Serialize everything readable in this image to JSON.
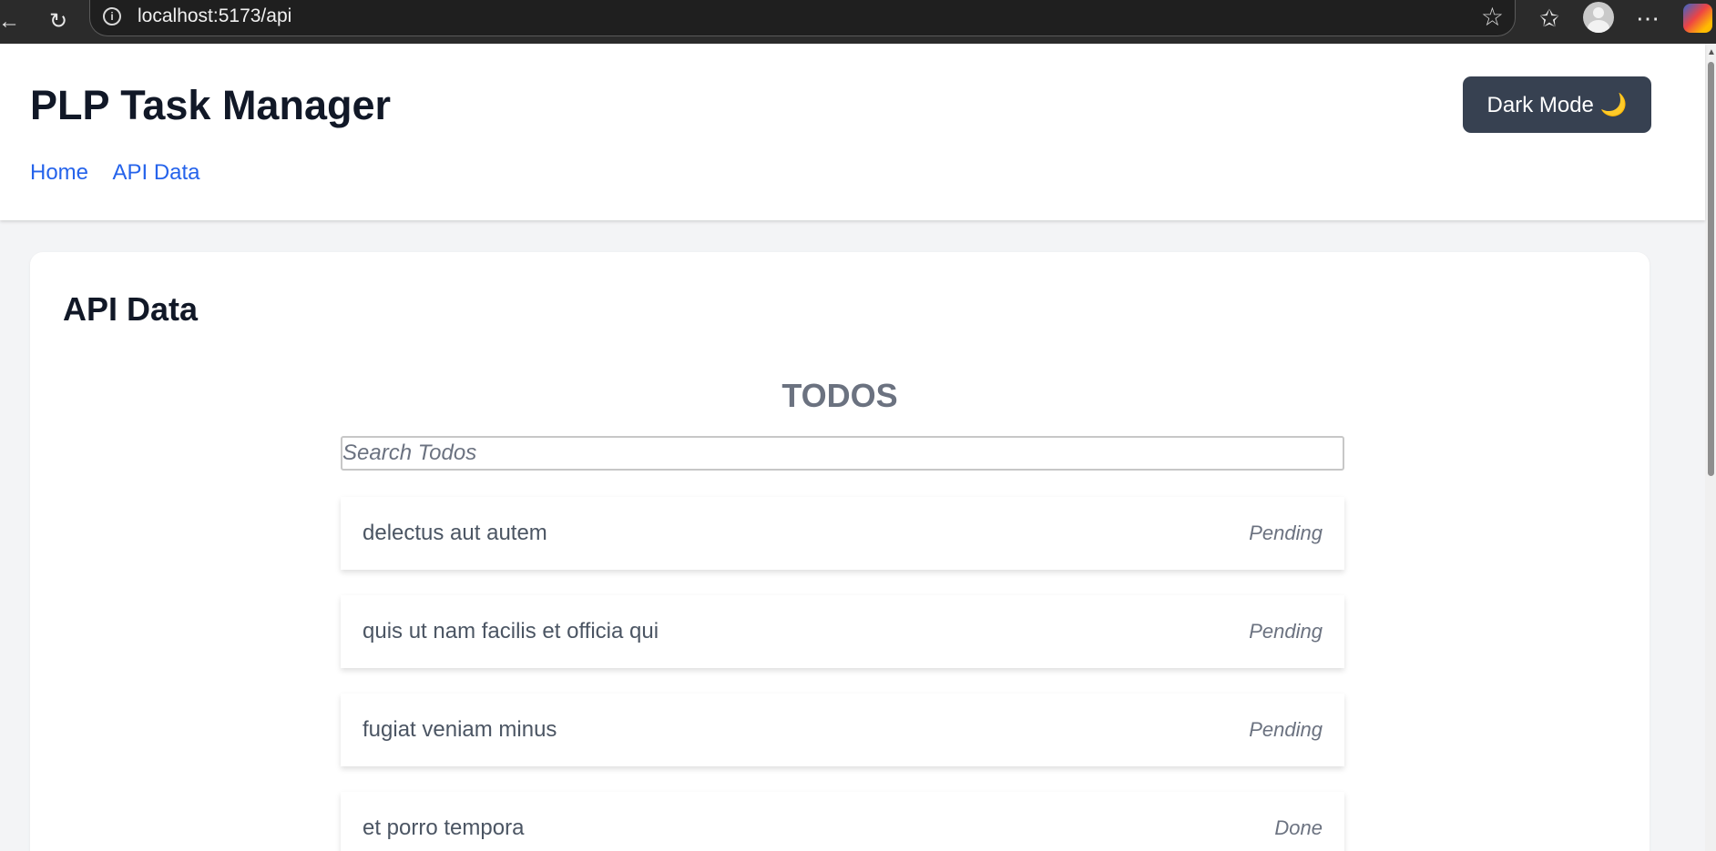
{
  "browser": {
    "url": "localhost:5173/api",
    "icons": [
      "back-arrow-icon",
      "refresh-icon",
      "info-icon",
      "star-icon",
      "favorites-icon",
      "profile-avatar",
      "more-icon",
      "copilot-icon"
    ]
  },
  "app": {
    "title": "PLP Task Manager",
    "nav": [
      {
        "label": "Home"
      },
      {
        "label": "API Data"
      }
    ],
    "dark_mode_label": "Dark Mode 🌙"
  },
  "page": {
    "heading": "API Data",
    "section_title": "TODOS",
    "search_placeholder": "Search Todos",
    "todos": [
      {
        "title": "delectus aut autem",
        "status": "Pending"
      },
      {
        "title": "quis ut nam facilis et officia qui",
        "status": "Pending"
      },
      {
        "title": "fugiat veniam minus",
        "status": "Pending"
      },
      {
        "title": "et porro tempora",
        "status": "Done"
      }
    ]
  }
}
